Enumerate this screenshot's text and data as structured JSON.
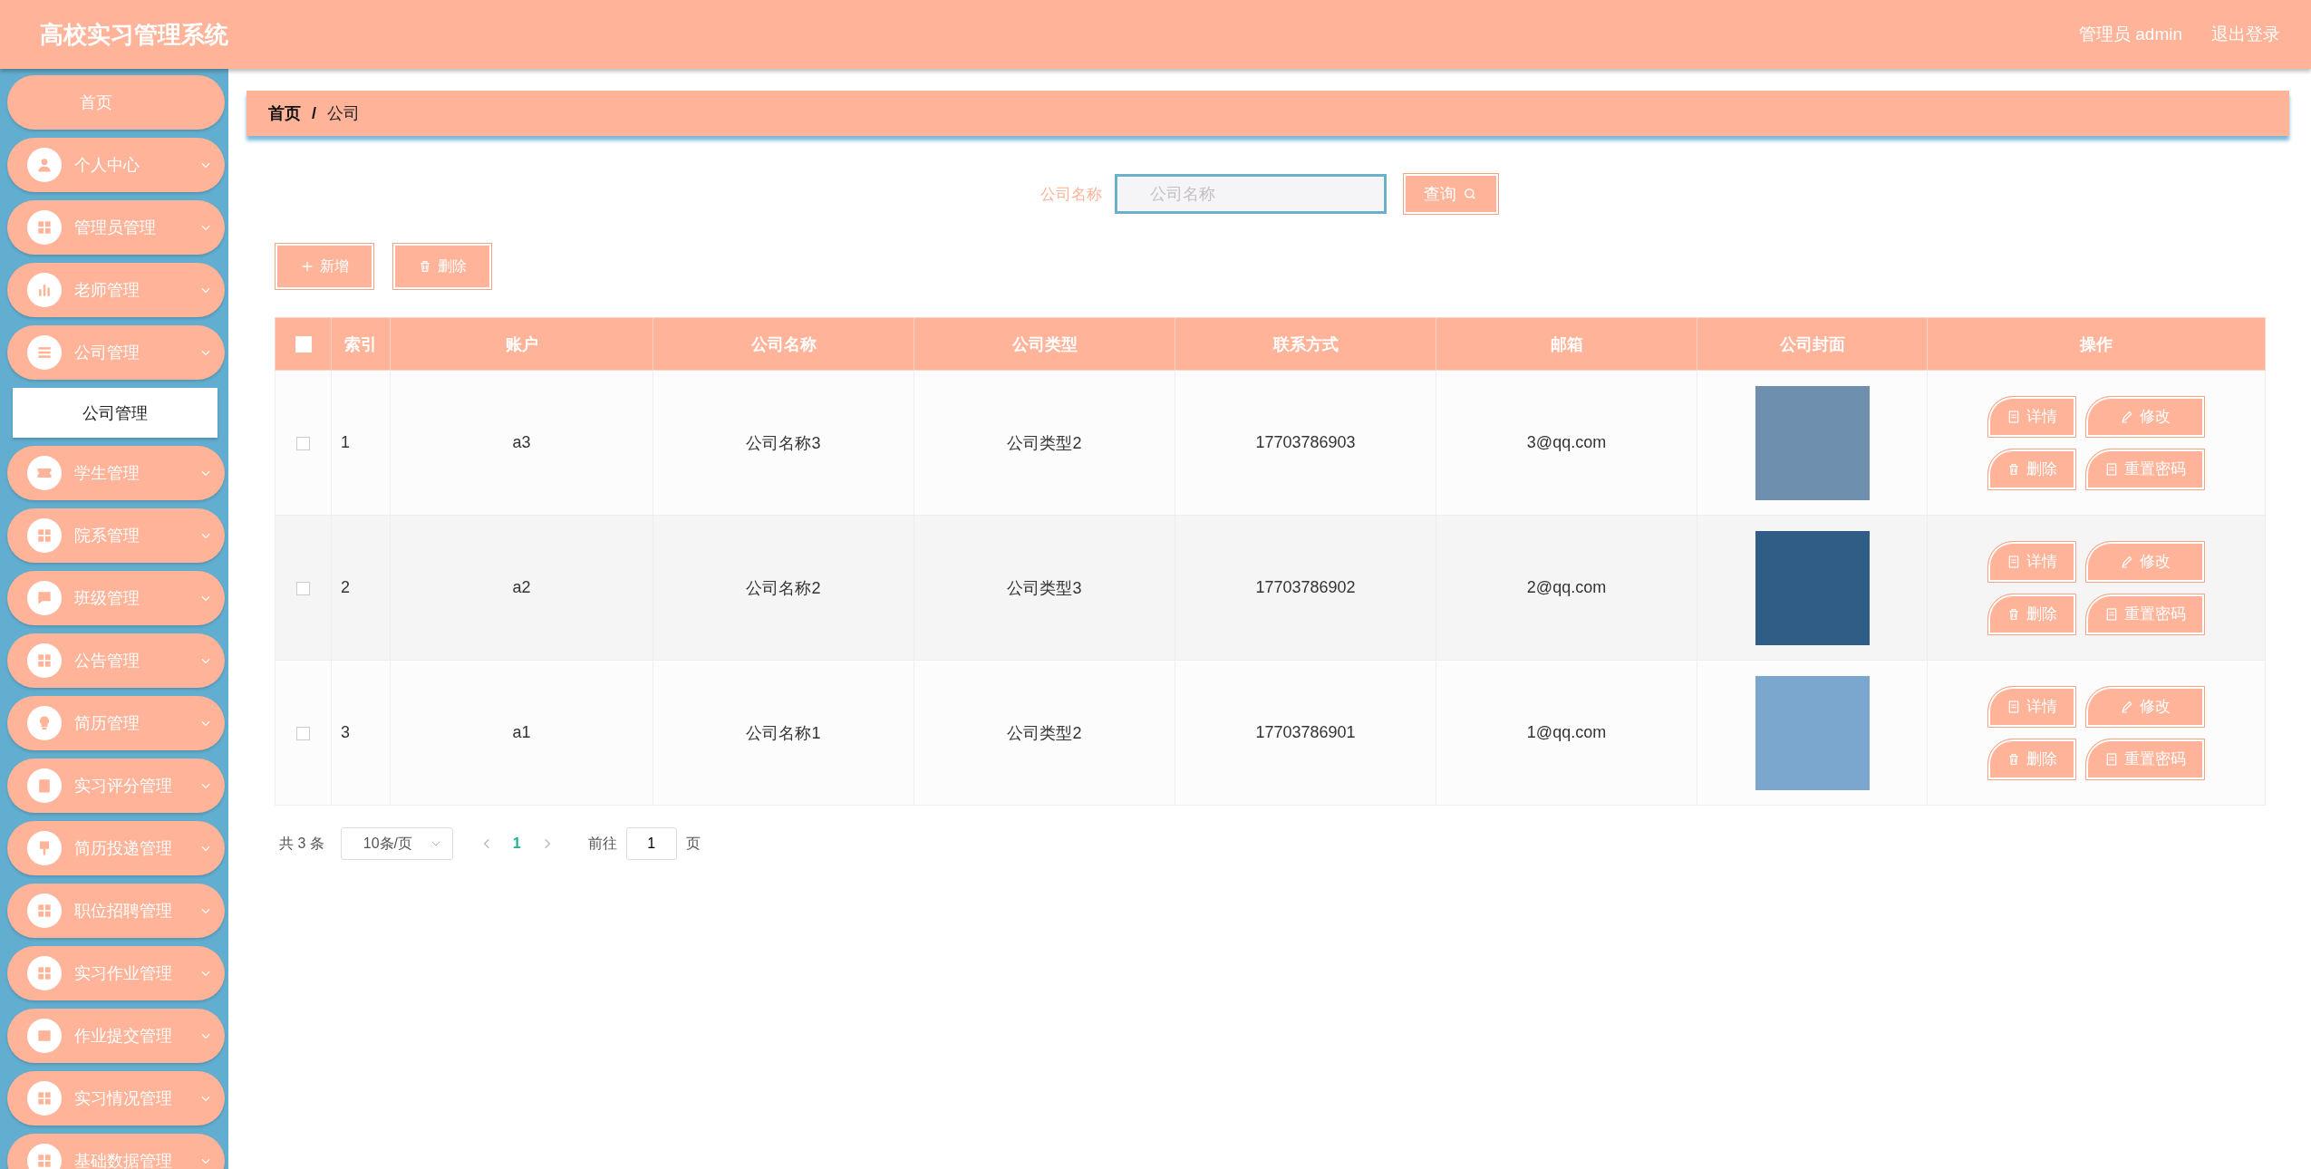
{
  "header": {
    "title": "高校实习管理系统",
    "user": "管理员 admin",
    "logout": "退出登录"
  },
  "sidebar": {
    "items": [
      {
        "label": "首页",
        "kind": "link"
      },
      {
        "label": "个人中心",
        "kind": "menu"
      },
      {
        "label": "管理员管理",
        "kind": "menu"
      },
      {
        "label": "老师管理",
        "kind": "menu"
      },
      {
        "label": "公司管理",
        "kind": "menu",
        "expanded": true,
        "children": [
          {
            "label": "公司管理",
            "selected": true
          }
        ]
      },
      {
        "label": "学生管理",
        "kind": "menu"
      },
      {
        "label": "院系管理",
        "kind": "menu"
      },
      {
        "label": "班级管理",
        "kind": "menu"
      },
      {
        "label": "公告管理",
        "kind": "menu"
      },
      {
        "label": "简历管理",
        "kind": "menu"
      },
      {
        "label": "实习评分管理",
        "kind": "menu"
      },
      {
        "label": "简历投递管理",
        "kind": "menu"
      },
      {
        "label": "职位招聘管理",
        "kind": "menu"
      },
      {
        "label": "实习作业管理",
        "kind": "menu"
      },
      {
        "label": "作业提交管理",
        "kind": "menu"
      },
      {
        "label": "实习情况管理",
        "kind": "menu"
      },
      {
        "label": "基础数据管理",
        "kind": "menu"
      }
    ]
  },
  "breadcrumb": {
    "home": "首页",
    "separator": "/",
    "current": "公司"
  },
  "search": {
    "label": "公司名称",
    "placeholder": "公司名称",
    "button": "查询"
  },
  "toolbar": [
    {
      "kind": "add",
      "label": "新增"
    },
    {
      "kind": "delete",
      "label": "删除"
    }
  ],
  "table": {
    "all_checked": false,
    "columns": [
      "索引",
      "账户",
      "公司名称",
      "公司类型",
      "联系方式",
      "邮箱",
      "公司封面",
      "操作"
    ],
    "rows": [
      {
        "checked": false,
        "cells": [
          "1",
          "a3",
          "公司名称3",
          "公司类型2",
          "17703786903",
          "3@qq.com"
        ],
        "actions": [
          {
            "kind": "detail",
            "label": "详情"
          },
          {
            "kind": "edit",
            "label": "修改"
          },
          {
            "kind": "delete",
            "label": "删除"
          },
          {
            "kind": "reset",
            "label": "重置密码"
          }
        ]
      },
      {
        "checked": false,
        "cells": [
          "2",
          "a2",
          "公司名称2",
          "公司类型3",
          "17703786902",
          "2@qq.com"
        ],
        "actions": [
          {
            "kind": "detail",
            "label": "详情"
          },
          {
            "kind": "edit",
            "label": "修改"
          },
          {
            "kind": "delete",
            "label": "删除"
          },
          {
            "kind": "reset",
            "label": "重置密码"
          }
        ]
      },
      {
        "checked": false,
        "cells": [
          "3",
          "a1",
          "公司名称1",
          "公司类型2",
          "17703786901",
          "1@qq.com"
        ],
        "actions": [
          {
            "kind": "detail",
            "label": "详情"
          },
          {
            "kind": "edit",
            "label": "修改"
          },
          {
            "kind": "delete",
            "label": "删除"
          },
          {
            "kind": "reset",
            "label": "重置密码"
          }
        ]
      }
    ]
  },
  "pagination": {
    "total": "共 3 条",
    "page_size": "10条/页",
    "pages": [
      {
        "label": "1",
        "selected": true
      }
    ],
    "goto": "前往",
    "goto_value": "1",
    "page_unit": "页"
  }
}
